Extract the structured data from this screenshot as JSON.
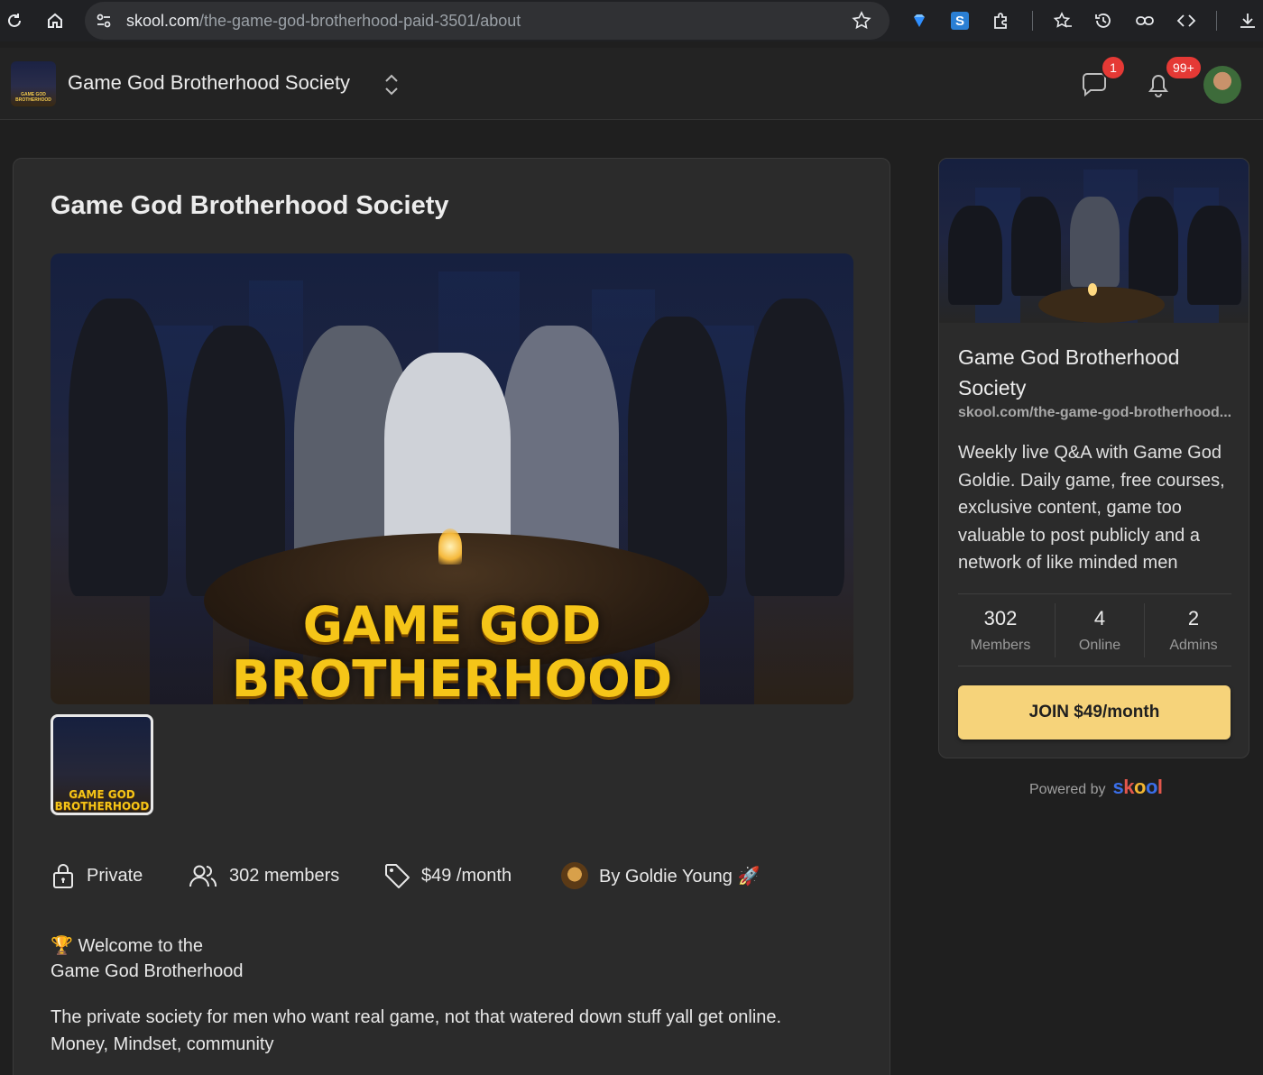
{
  "browser": {
    "url_domain": "skool.com",
    "url_path": "/the-game-god-brotherhood-paid-3501/about"
  },
  "header": {
    "group_name": "Game God Brotherhood Society",
    "logo_text": "GAME GOD BROTHERHOOD",
    "chat_badge": "1",
    "notifications_badge": "99+"
  },
  "main": {
    "title": "Game God Brotherhood Society",
    "hero_line1": "GAME GOD",
    "hero_line2": "BROTHERHOOD",
    "thumb_line1": "GAME GOD",
    "thumb_line2": "BROTHERHOOD",
    "meta": {
      "privacy": "Private",
      "members": "302 members",
      "price": "$49 /month",
      "author": "By Goldie Young 🚀"
    },
    "welcome_line1": "🏆 Welcome to the",
    "welcome_line2": "Game God Brotherhood",
    "description_line1": "The private society for men who want real game, not that watered down stuff yall get online.",
    "description_line2": "Money, Mindset, community"
  },
  "sidebar": {
    "title": "Game God Brotherhood Society",
    "url": "skool.com/the-game-god-brotherhood...",
    "description": "Weekly live Q&A with Game God Goldie. Daily game, free courses, exclusive content, game too valuable to post publicly and a network of like minded men",
    "stats": [
      {
        "value": "302",
        "label": "Members"
      },
      {
        "value": "4",
        "label": "Online"
      },
      {
        "value": "2",
        "label": "Admins"
      }
    ],
    "join_label": "JOIN $49/month",
    "powered_by": "Powered by",
    "brand": "skool"
  },
  "colors": {
    "background": "#1f1f1f",
    "card": "#2b2b2b",
    "join_button": "#f6d37a",
    "badge": "#e53935",
    "hero_text": "#f5c518"
  }
}
